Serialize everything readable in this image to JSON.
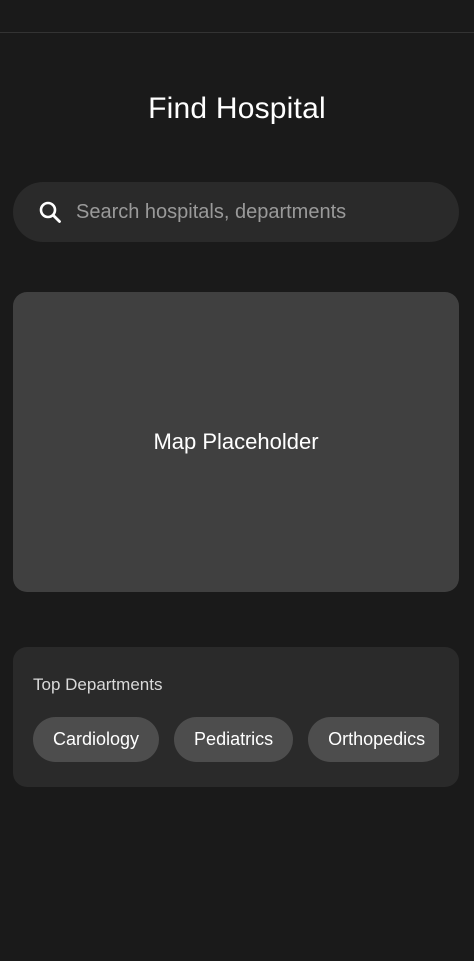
{
  "header": {
    "title": "Find Hospital"
  },
  "search": {
    "icon": "search-icon",
    "placeholder": "Search hospitals, departments",
    "value": ""
  },
  "map": {
    "label": "Map Placeholder"
  },
  "departments": {
    "title": "Top Departments",
    "items": [
      {
        "label": "Cardiology"
      },
      {
        "label": "Pediatrics"
      },
      {
        "label": "Orthopedics"
      }
    ]
  },
  "colors": {
    "background": "#1a1a1a",
    "card": "#2a2a2a",
    "map": "#404040",
    "chip": "#4d4d4d",
    "text": "#ffffff",
    "muted_text": "#9a9a9a"
  }
}
